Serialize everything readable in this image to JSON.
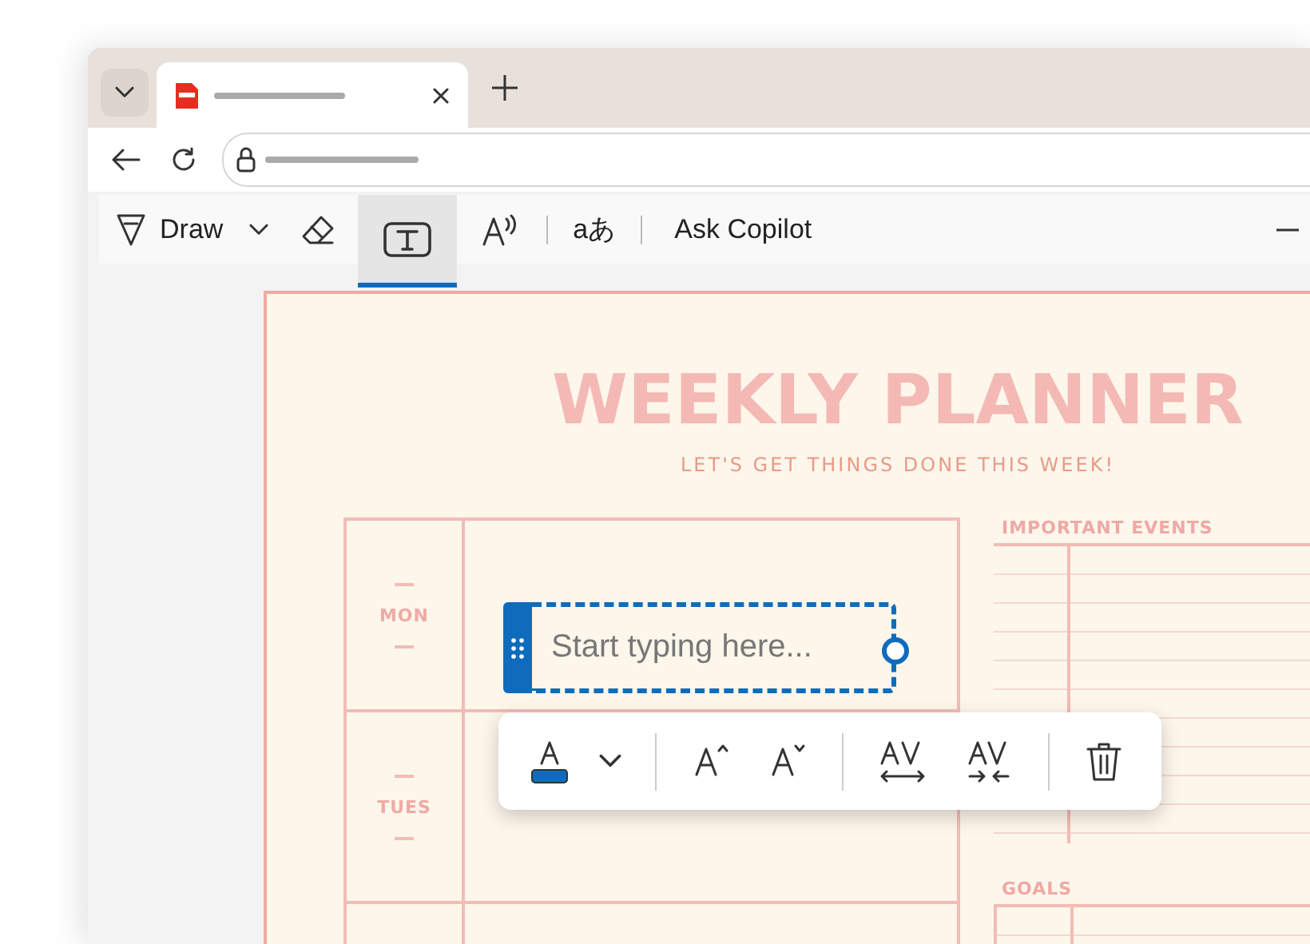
{
  "browser": {
    "tabs": [
      {
        "kind": "pdf",
        "selected": true
      }
    ]
  },
  "toolbar": {
    "items": [
      {
        "kind": "draw",
        "label": "Draw",
        "selected": false
      },
      {
        "kind": "dropdown",
        "selected": false
      },
      {
        "kind": "erase",
        "selected": false
      },
      {
        "kind": "text",
        "selected": true
      },
      {
        "kind": "read-aloud",
        "selected": false
      },
      {
        "kind": "translate",
        "label": "aあ",
        "selected": false
      },
      {
        "kind": "copilot",
        "label": "Ask Copilot",
        "selected": false
      },
      {
        "kind": "minimize",
        "selected": false
      }
    ]
  },
  "document": {
    "title": "WEEKLY PLANNER",
    "subtitle": "LET'S GET THINGS DONE THIS WEEK!",
    "days": [
      {
        "label": "MON"
      },
      {
        "label": "TUES"
      }
    ],
    "events_heading": "IMPORTANT EVENTS",
    "goals_heading": "GOALS"
  },
  "text_box": {
    "placeholder": "Start typing here..."
  },
  "format_toolbar": {
    "items": [
      {
        "kind": "font-color"
      },
      {
        "kind": "caret"
      },
      {
        "kind": "separator"
      },
      {
        "kind": "grow"
      },
      {
        "kind": "shrink"
      },
      {
        "kind": "separator"
      },
      {
        "kind": "expand"
      },
      {
        "kind": "condense"
      },
      {
        "kind": "separator"
      },
      {
        "kind": "delete"
      }
    ]
  }
}
